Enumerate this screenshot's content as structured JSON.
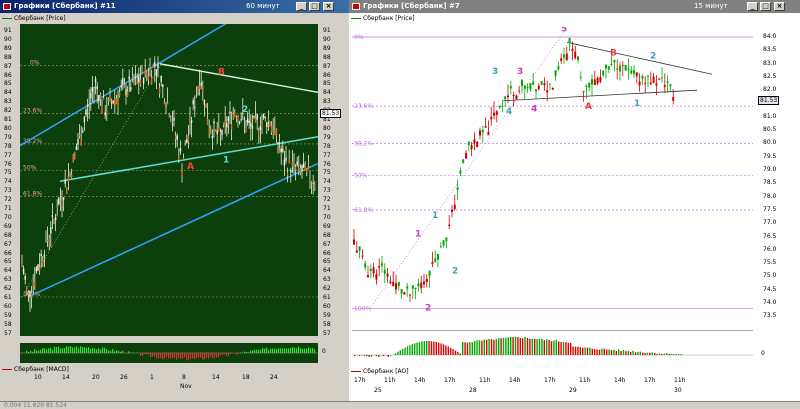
{
  "left": {
    "title": "Графики [Сбербанк] #11",
    "timeframe": "60 минут",
    "legend": "Сбербанк [Price]",
    "macd_legend": "Сбербанк [MACD]",
    "price_badge": "81.53",
    "macd_zero": "0",
    "axis_labels": [
      "91",
      "90",
      "89",
      "88",
      "87",
      "86",
      "85",
      "84",
      "83",
      "82",
      "81",
      "80",
      "79",
      "78",
      "77",
      "76",
      "75",
      "74",
      "73",
      "72",
      "71",
      "70",
      "69",
      "68",
      "67",
      "66",
      "65",
      "64",
      "63",
      "62",
      "61",
      "60",
      "59",
      "58",
      "57"
    ],
    "fib_labels": [
      "0%",
      "23.6%",
      "38.2%",
      "50%",
      "61.8%",
      "100%"
    ],
    "wave_labels": [
      "B",
      "A",
      "1",
      "2"
    ],
    "time_labels": [
      "10",
      "14",
      "20",
      "26",
      "1",
      "8",
      "14",
      "18",
      "24"
    ],
    "month_label": "Nov"
  },
  "right": {
    "title": "Графики [Сбербанк] #7",
    "timeframe": "15 минут",
    "legend": "Сбербанк [Price]",
    "ao_legend": "Сбербанк [AO]",
    "price_badge": "81.53",
    "ao_zero": "0",
    "axis_labels": [
      "84.0",
      "83.5",
      "83.0",
      "82.5",
      "82.0",
      "81.5",
      "81.0",
      "80.5",
      "80.0",
      "79.5",
      "79.0",
      "78.5",
      "78.0",
      "77.5",
      "77.0",
      "76.5",
      "76.0",
      "75.5",
      "75.0",
      "74.5",
      "74.0",
      "73.5",
      "73.0"
    ],
    "fib_labels": [
      "0%",
      "23.6%",
      "38.2%",
      "50%",
      "61.8%",
      "100%"
    ],
    "wave_labels": [
      "5",
      "B",
      "2",
      "3",
      "3",
      "4",
      "4",
      "A",
      "1",
      "1",
      "1",
      "2"
    ],
    "time_labels": [
      "17h",
      "11h",
      "14h",
      "17h",
      "11h",
      "14h",
      "17h",
      "11h",
      "14h",
      "17h",
      "11h"
    ],
    "date_labels": [
      "25",
      "28",
      "29",
      "30"
    ]
  },
  "status": "0.004   11.820   81.524"
}
